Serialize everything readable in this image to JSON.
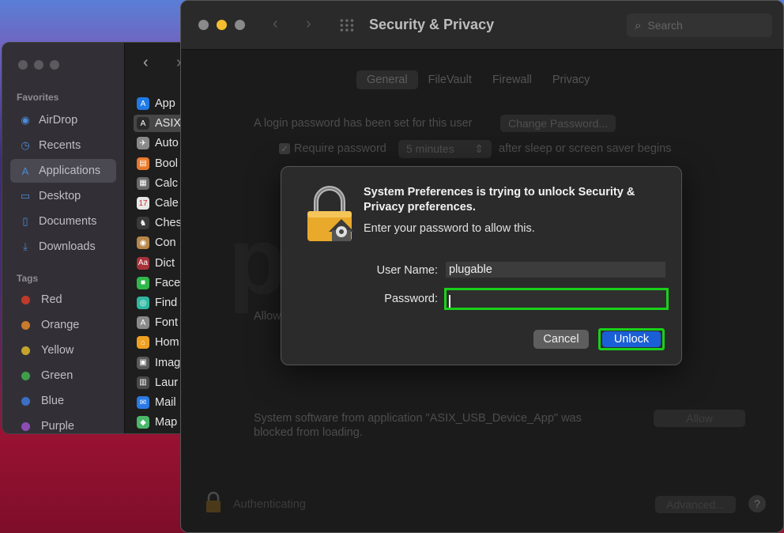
{
  "finder": {
    "favorites_heading": "Favorites",
    "favorites": [
      {
        "label": "AirDrop",
        "icon": "airdrop-icon"
      },
      {
        "label": "Recents",
        "icon": "clock-icon"
      },
      {
        "label": "Applications",
        "icon": "applications-icon"
      },
      {
        "label": "Desktop",
        "icon": "desktop-icon"
      },
      {
        "label": "Documents",
        "icon": "document-icon"
      },
      {
        "label": "Downloads",
        "icon": "download-icon"
      }
    ],
    "tags_heading": "Tags",
    "tags": [
      {
        "label": "Red",
        "color": "#c0392b"
      },
      {
        "label": "Orange",
        "color": "#c97a2a"
      },
      {
        "label": "Yellow",
        "color": "#c4a42c"
      },
      {
        "label": "Green",
        "color": "#3f9e4a"
      },
      {
        "label": "Blue",
        "color": "#3a6fc4"
      },
      {
        "label": "Purple",
        "color": "#8e4db4"
      }
    ],
    "files": [
      {
        "label": "App",
        "color": "#1f7ae6",
        "glyph": "A"
      },
      {
        "label": "ASIX",
        "color": "#2a2a2a",
        "glyph": "A"
      },
      {
        "label": "Auto",
        "color": "#8a8a8a",
        "glyph": "✈"
      },
      {
        "label": "Bool",
        "color": "#e8792a",
        "glyph": "▤"
      },
      {
        "label": "Calc",
        "color": "#6a6a6a",
        "glyph": "▦"
      },
      {
        "label": "Cale",
        "color": "#e8e8e8",
        "glyph": "17"
      },
      {
        "label": "Ches",
        "color": "#3a3a3a",
        "glyph": "♞"
      },
      {
        "label": "Con",
        "color": "#b8874a",
        "glyph": "◉"
      },
      {
        "label": "Dict",
        "color": "#a8323a",
        "glyph": "Aa"
      },
      {
        "label": "Face",
        "color": "#2fb84a",
        "glyph": "■"
      },
      {
        "label": "Find",
        "color": "#2fb8a0",
        "glyph": "◎"
      },
      {
        "label": "Font",
        "color": "#8a8a8a",
        "glyph": "A"
      },
      {
        "label": "Hom",
        "color": "#f0a020",
        "glyph": "⌂"
      },
      {
        "label": "Imag",
        "color": "#5a5a5a",
        "glyph": "▣"
      },
      {
        "label": "Laur",
        "color": "#4a4a4a",
        "glyph": "▥"
      },
      {
        "label": "Mail",
        "color": "#2a7ae6",
        "glyph": "✉"
      },
      {
        "label": "Map",
        "color": "#4ab86a",
        "glyph": "◆"
      }
    ]
  },
  "prefs": {
    "title": "Security & Privacy",
    "search_placeholder": "Search",
    "tabs": [
      "General",
      "FileVault",
      "Firewall",
      "Privacy"
    ],
    "login_password_text": "A login password has been set for this user",
    "change_password_label": "Change Password...",
    "require_password_label": "Require password",
    "require_password_value": "5 minutes",
    "after_sleep_text": "after sleep or screen saver begins",
    "allow_partial": "Allow",
    "blocked_text_line1": "System software from application \"ASIX_USB_Device_App\" was",
    "blocked_text_line2": "blocked from loading.",
    "allow_button": "Allow",
    "authenticating_text": "Authenticating",
    "advanced_button": "Advanced...",
    "help_glyph": "?"
  },
  "dialog": {
    "title": "System Preferences is trying to unlock Security & Privacy preferences.",
    "subtitle": "Enter your password to allow this.",
    "username_label": "User Name:",
    "username_value": "plugable",
    "password_label": "Password:",
    "password_value": "",
    "cancel_label": "Cancel",
    "unlock_label": "Unlock",
    "highlight_color": "#19d119"
  },
  "watermark": "plugable"
}
